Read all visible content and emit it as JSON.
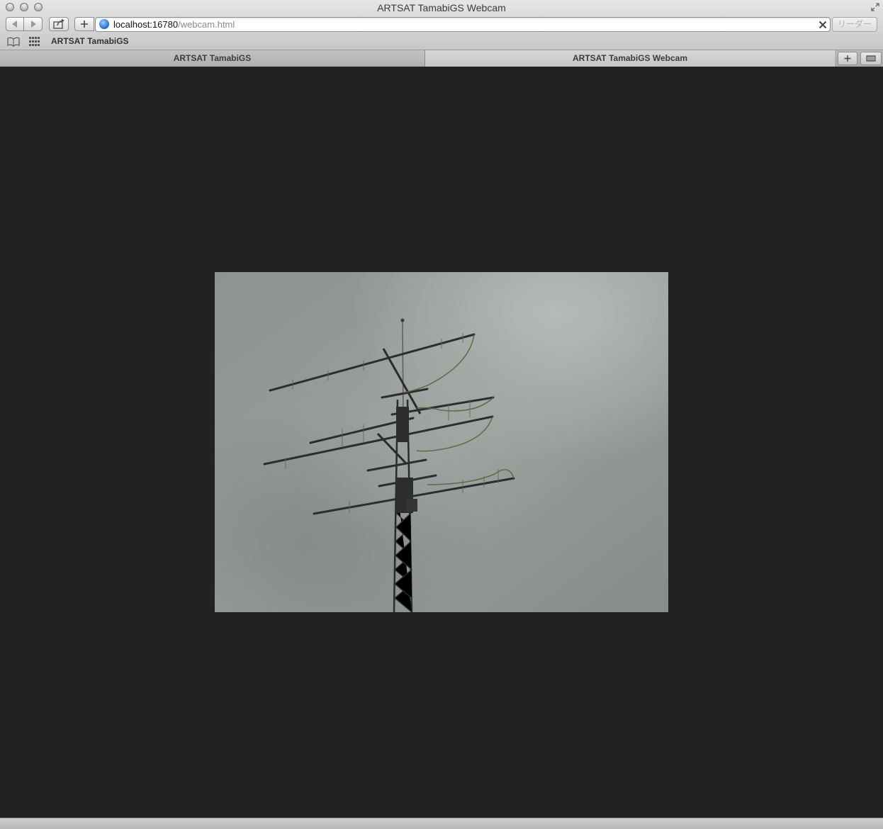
{
  "window": {
    "title": "ARTSAT TamabiGS Webcam"
  },
  "toolbar": {
    "url_host": "localhost:16780",
    "url_path": "/webcam.html",
    "reader_label": "リーダー"
  },
  "bookmarks": {
    "items": [
      {
        "label": "ARTSAT TamabiGS"
      }
    ]
  },
  "tabs": [
    {
      "label": "ARTSAT TamabiGS",
      "active": false
    },
    {
      "label": "ARTSAT TamabiGS Webcam",
      "active": true
    }
  ],
  "page": {
    "background": "#222222",
    "webcam_image": "antenna-tower-cloudy-sky"
  }
}
